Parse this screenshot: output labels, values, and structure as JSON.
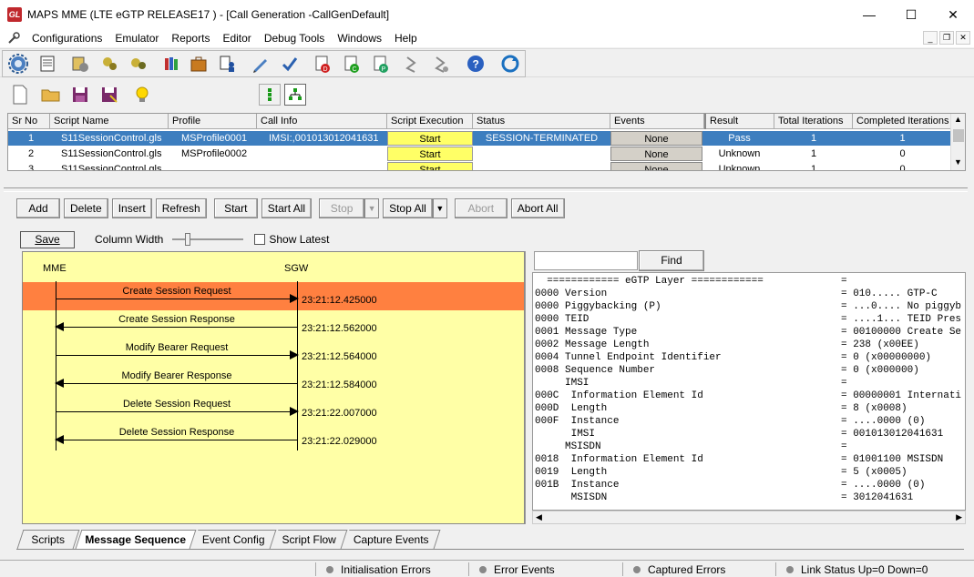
{
  "window": {
    "app_icon_text": "GL",
    "title": "MAPS MME (LTE eGTP RELEASE17 ) - [Call Generation  -CallGenDefault]"
  },
  "menu": [
    "Configurations",
    "Emulator",
    "Reports",
    "Editor",
    "Debug Tools",
    "Windows",
    "Help"
  ],
  "grid": {
    "columns": [
      "Sr No",
      "Script Name",
      "Profile",
      "Call Info",
      "Script Execution",
      "Status",
      "Events",
      "Result",
      "Total Iterations",
      "Completed Iterations"
    ],
    "rows": [
      {
        "sr": "1",
        "script": "S11SessionControl.gls",
        "profile": "MSProfile0001",
        "callinfo": "IMSI:,001013012041631",
        "exec": "Start",
        "status": "SESSION-TERMINATED",
        "events": "None",
        "result": "Pass",
        "total": "1",
        "completed": "1"
      },
      {
        "sr": "2",
        "script": "S11SessionControl.gls",
        "profile": "MSProfile0002",
        "callinfo": "",
        "exec": "Start",
        "status": "",
        "events": "None",
        "result": "Unknown",
        "total": "1",
        "completed": "0"
      },
      {
        "sr": "3",
        "script": "S11SessionControl.gls",
        "profile": "",
        "callinfo": "",
        "exec": "Start",
        "status": "",
        "events": "None",
        "result": "Unknown",
        "total": "1",
        "completed": "0"
      }
    ]
  },
  "controls": {
    "add": "Add",
    "delete": "Delete",
    "insert": "Insert",
    "refresh": "Refresh",
    "start": "Start",
    "start_all": "Start All",
    "stop": "Stop",
    "stop_all": "Stop All",
    "abort": "Abort",
    "abort_all": "Abort All"
  },
  "sequence_toolbar": {
    "save": "Save",
    "column_width": "Column Width",
    "show_latest": "Show Latest"
  },
  "sequence": {
    "lanes": [
      "MME",
      "SGW"
    ],
    "messages": [
      {
        "label": "Create Session Request",
        "time": "23:21:12.425000",
        "direction": "right"
      },
      {
        "label": "Create Session Response",
        "time": "23:21:12.562000",
        "direction": "left"
      },
      {
        "label": "Modify Bearer Request",
        "time": "23:21:12.564000",
        "direction": "right"
      },
      {
        "label": "Modify Bearer Response",
        "time": "23:21:12.584000",
        "direction": "left"
      },
      {
        "label": "Delete Session Request",
        "time": "23:21:22.007000",
        "direction": "right"
      },
      {
        "label": "Delete Session Response",
        "time": "23:21:22.029000",
        "direction": "left"
      }
    ]
  },
  "decode": {
    "find": "Find",
    "lines": [
      {
        "left": "  ============ eGTP Layer ============",
        "right": "="
      },
      {
        "left": "0000 Version",
        "right": "= 010..... GTP-C"
      },
      {
        "left": "0000 Piggybacking (P)",
        "right": "= ...0.... No piggyb"
      },
      {
        "left": "0000 TEID",
        "right": "= ....1... TEID Pres"
      },
      {
        "left": "0001 Message Type",
        "right": "= 00100000 Create Se"
      },
      {
        "left": "0002 Message Length",
        "right": "= 238 (x00EE)"
      },
      {
        "left": "0004 Tunnel Endpoint Identifier",
        "right": "= 0 (x00000000)"
      },
      {
        "left": "0008 Sequence Number",
        "right": "= 0 (x000000)"
      },
      {
        "left": "     IMSI",
        "right": "="
      },
      {
        "left": "000C  Information Element Id",
        "right": "= 00000001 Internati"
      },
      {
        "left": "000D  Length",
        "right": "= 8 (x0008)"
      },
      {
        "left": "000F  Instance",
        "right": "= ....0000 (0)"
      },
      {
        "left": "      IMSI",
        "right": "= 001013012041631"
      },
      {
        "left": "     MSISDN",
        "right": "="
      },
      {
        "left": "0018  Information Element Id",
        "right": "= 01001100 MSISDN"
      },
      {
        "left": "0019  Length",
        "right": "= 5 (x0005)"
      },
      {
        "left": "001B  Instance",
        "right": "= ....0000 (0)"
      },
      {
        "left": "      MSISDN",
        "right": "= 3012041631"
      }
    ]
  },
  "tabs": [
    "Scripts",
    "Message Sequence",
    "Event Config",
    "Script Flow",
    "Capture Events"
  ],
  "statusbar": {
    "init_errors": "Initialisation Errors",
    "error_events": "Error Events",
    "captured_errors": "Captured Errors",
    "link_status": "Link Status Up=0 Down=0"
  }
}
